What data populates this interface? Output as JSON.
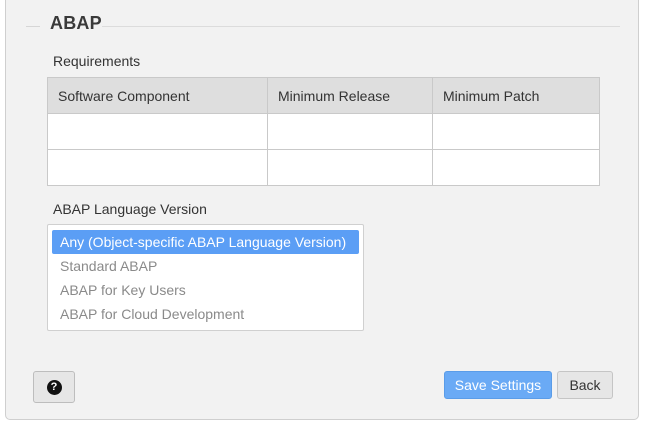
{
  "section": {
    "title": "ABAP"
  },
  "requirements": {
    "label": "Requirements",
    "columns": [
      "Software Component",
      "Minimum Release",
      "Minimum Patch"
    ],
    "rows": [
      [
        "",
        "",
        ""
      ],
      [
        "",
        "",
        ""
      ]
    ]
  },
  "language_version": {
    "label": "ABAP Language Version",
    "options": [
      "Any (Object-specific ABAP Language Version)",
      "Standard ABAP",
      "ABAP for Key Users",
      "ABAP for Cloud Development"
    ],
    "selected": "Any (Object-specific ABAP Language Version)"
  },
  "footer": {
    "help_icon": "question-circle-icon",
    "save_label": "Save Settings",
    "back_label": "Back"
  },
  "colors": {
    "accent": "#5b9ef5",
    "save_button": "#6aaaf5",
    "panel_background": "#f2f2f2",
    "header_background": "#dedede"
  }
}
